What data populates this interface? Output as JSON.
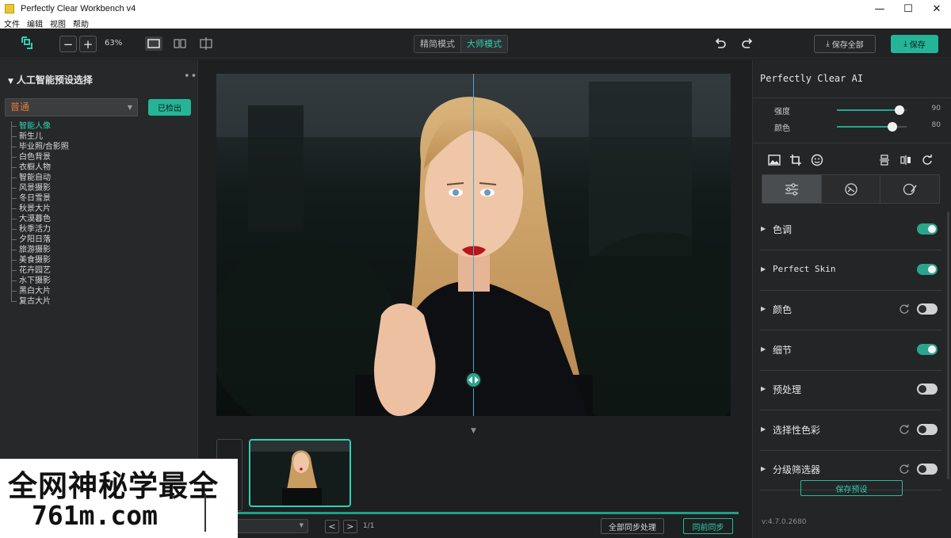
{
  "window": {
    "title": "Perfectly Clear Workbench v4",
    "minimize": "—",
    "maximize": "☐",
    "close": "✕"
  },
  "menu": [
    "文件",
    "编辑",
    "视图",
    "帮助"
  ],
  "toolbar": {
    "zoom_out": "−",
    "zoom_in": "+",
    "zoom_level": "63%",
    "modes": [
      "精简模式",
      "大师模式"
    ],
    "active_mode": 1,
    "save_all": "保存全部",
    "save": "保存"
  },
  "left_panel": {
    "title": "人工智能预设选择",
    "more": "•••",
    "preset_selected": "普通",
    "detect_button": "已检出",
    "presets": [
      "智能人像",
      "新生儿",
      "毕业照/合影照",
      "白色背景",
      "衣橱人物",
      "智能自动",
      "风景摄影",
      "冬日雪景",
      "秋景大片",
      "大漠暮色",
      "秋季活力",
      "夕阳日落",
      "旅游摄影",
      "美食摄影",
      "花卉园艺",
      "水下摄影",
      "黑白大片",
      "复古大片"
    ],
    "active_preset": 0
  },
  "filmstrip": {
    "nav_prev": "<",
    "nav_next": ">",
    "page": "1/1",
    "sync_all": "全部同步处理",
    "sync": "同前同步",
    "progress": 1.0
  },
  "right_panel": {
    "title": "Perfectly Clear AI",
    "sliders": [
      {
        "label": "强度",
        "value": 90
      },
      {
        "label": "颜色",
        "value": 80
      }
    ],
    "sections": [
      {
        "label": "色调",
        "enabled": true,
        "reset": false,
        "mono": false
      },
      {
        "label": "Perfect Skin",
        "enabled": true,
        "reset": false,
        "mono": true
      },
      {
        "label": "颜色",
        "enabled": false,
        "reset": true,
        "mono": false
      },
      {
        "label": "细节",
        "enabled": true,
        "reset": false,
        "mono": false
      },
      {
        "label": "预处理",
        "enabled": false,
        "reset": false,
        "mono": false
      },
      {
        "label": "选择性色彩",
        "enabled": false,
        "reset": true,
        "mono": false
      },
      {
        "label": "分级筛选器",
        "enabled": false,
        "reset": true,
        "mono": false
      }
    ],
    "save_preset": "保存预设",
    "version": "v:4.7.0.2680"
  },
  "watermark": {
    "line1": "全网神秘学最全",
    "line2": "761m.com"
  },
  "colors": {
    "accent": "#24b596",
    "accent_text": "#2fd0b0",
    "preset_text": "#e0793a",
    "background": "#1c1e20"
  }
}
